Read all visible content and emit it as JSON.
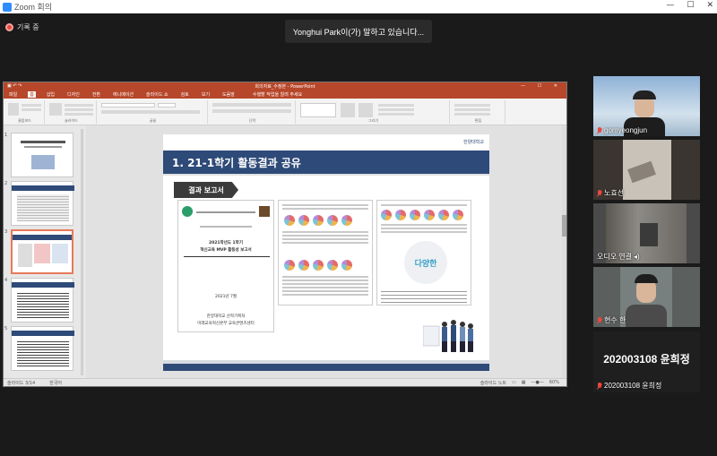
{
  "window": {
    "title": "Zoom 회의"
  },
  "recording": {
    "label": "기록 중"
  },
  "speaker_banner": "Yonghui Park이(가) 말하고 있습니다...",
  "ppt": {
    "filename": "회의자료_수정본 - PowerPoint",
    "tabs": [
      "파일",
      "홈",
      "삽입",
      "디자인",
      "전환",
      "애니메이션",
      "슬라이드 쇼",
      "검토",
      "보기",
      "도움말"
    ],
    "active_tab": "홈",
    "tell_me": "수행할 작업을 알려 주세요",
    "ribbon_groups": [
      "클립보드",
      "슬라이드",
      "글꼴",
      "단락",
      "그리기",
      "편집"
    ],
    "thumbnails": [
      "1",
      "2",
      "3",
      "4",
      "5"
    ],
    "selected_thumbnail": 2,
    "status": {
      "slide": "슬라이드 3/14",
      "lang": "한국어",
      "notes": "슬라이드 노트",
      "zoom": "60%"
    }
  },
  "slide": {
    "heading": "1. 21-1학기 활동결과 공유",
    "tag": "결과 보고서",
    "logo": "한양대학교",
    "doc1": {
      "title": "2021학년도 1학기",
      "subtitle": "혁신교육 MVP 활동성 보고서",
      "date": "2021년 7월",
      "org1": "한양대학교 산학기획처",
      "org2": "미래교육혁신본부 교육콘텐츠센터"
    },
    "cloud_word": "다양한"
  },
  "participants": [
    {
      "name": "gomyeongjun",
      "muted": true,
      "video": true
    },
    {
      "name": "노효선",
      "muted": true,
      "video": true
    },
    {
      "name": "오디오 연결",
      "muted": false,
      "video": true
    },
    {
      "name": "현수 한",
      "muted": true,
      "video": true
    },
    {
      "name": "202003108 윤희정",
      "muted": true,
      "video": false,
      "display": "202003108 윤희정"
    }
  ],
  "colors": {
    "ppt_accent": "#b7472a",
    "slide_navy": "#2e4a78",
    "muted_red": "#e8483d"
  }
}
